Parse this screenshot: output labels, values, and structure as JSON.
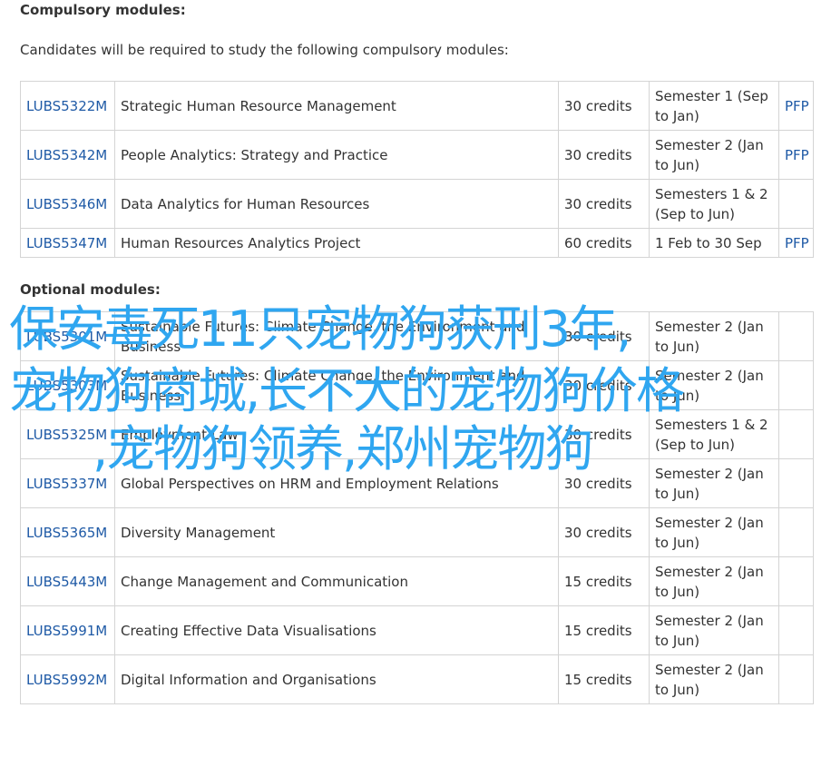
{
  "compulsory": {
    "heading": "Compulsory modules:",
    "intro": "Candidates will be required to study the following compulsory modules:",
    "rows": [
      {
        "code": "LUBS5322M",
        "title": "Strategic Human Resource Management",
        "credits": "30 credits",
        "semester": "Semester 1 (Sep to Jan)",
        "pfp": "PFP"
      },
      {
        "code": "LUBS5342M",
        "title": "People Analytics: Strategy and Practice",
        "credits": "30 credits",
        "semester": "Semester 2 (Jan to Jun)",
        "pfp": "PFP"
      },
      {
        "code": "LUBS5346M",
        "title": "Data Analytics for Human Resources",
        "credits": "30 credits",
        "semester": "Semesters 1 & 2 (Sep to Jun)",
        "pfp": ""
      },
      {
        "code": "LUBS5347M",
        "title": "Human Resources Analytics Project",
        "credits": "60 credits",
        "semester": "1 Feb to 30 Sep",
        "pfp": "PFP"
      }
    ]
  },
  "optional": {
    "heading": "Optional modules:",
    "rows": [
      {
        "code": "LUBS5301M",
        "title": "Sustainable Futures: Climate Change, the Environment and Business",
        "credits": "30 credits",
        "semester": "Semester 2 (Jan to Jun)",
        "pfp": ""
      },
      {
        "code": "LUBS5303M",
        "title": "Sustainable Futures: Climate Change, the Environment and Business",
        "credits": "30 credits",
        "semester": "Semester 2 (Jan to Jun)",
        "pfp": ""
      },
      {
        "code": "LUBS5325M",
        "title": "Employment Law",
        "credits": "30 credits",
        "semester": "Semesters 1 & 2 (Sep to Jun)",
        "pfp": ""
      },
      {
        "code": "LUBS5337M",
        "title": "Global Perspectives on HRM and Employment Relations",
        "credits": "30 credits",
        "semester": "Semester 2 (Jan to Jun)",
        "pfp": ""
      },
      {
        "code": "LUBS5365M",
        "title": "Diversity Management",
        "credits": "30 credits",
        "semester": "Semester 2 (Jan to Jun)",
        "pfp": ""
      },
      {
        "code": "LUBS5443M",
        "title": "Change Management and Communication",
        "credits": "15 credits",
        "semester": "Semester 2 (Jan to Jun)",
        "pfp": ""
      },
      {
        "code": "LUBS5991M",
        "title": "Creating Effective Data Visualisations",
        "credits": "15 credits",
        "semester": "Semester 2 (Jan to Jun)",
        "pfp": ""
      },
      {
        "code": "LUBS5992M",
        "title": "Digital Information and Organisations",
        "credits": "15 credits",
        "semester": "Semester 2 (Jan to Jun)",
        "pfp": ""
      }
    ]
  },
  "overlay": {
    "line1": "保安毒死11只宠物狗获刑3年,",
    "line2": "宠物狗商城,长不大的宠物狗价格",
    "line3": ",宠物狗领养,郑州宠物狗",
    "color": "#2fa6f0"
  },
  "colors": {
    "link": "#1f5aa6",
    "border": "#d4d4d4",
    "text": "#333333"
  }
}
